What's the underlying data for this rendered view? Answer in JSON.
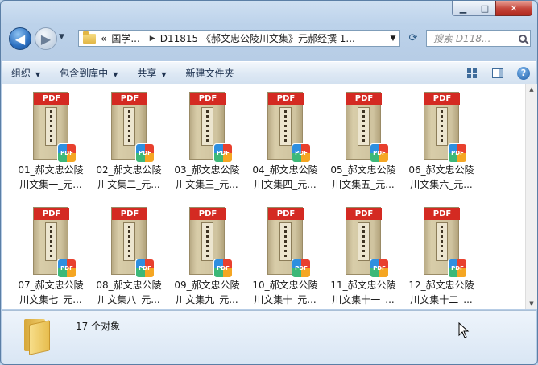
{
  "window": {
    "caption_buttons": {
      "minimize": "▁",
      "maximize": "□",
      "close": "✕"
    }
  },
  "nav": {
    "back_glyph": "◀",
    "forward_glyph": "▶",
    "dropdown_glyph": "▼",
    "breadcrumb": {
      "overflow": "«",
      "items": [
        "国学...",
        "D11815 《郝文忠公陵川文集》元郝经撰 1..."
      ],
      "separator": "▶"
    },
    "refresh_glyph": "⟳",
    "search_placeholder": "搜索 D118..."
  },
  "toolbar": {
    "items": [
      {
        "label": "组织",
        "has_menu": true
      },
      {
        "label": "包含到库中",
        "has_menu": true
      },
      {
        "label": "共享",
        "has_menu": true
      },
      {
        "label": "新建文件夹",
        "has_menu": false
      }
    ],
    "menu_arrow": "▼",
    "help_glyph": "?"
  },
  "files": [
    {
      "line1": "01_郝文忠公陵",
      "line2": "川文集一_元..."
    },
    {
      "line1": "02_郝文忠公陵",
      "line2": "川文集二_元..."
    },
    {
      "line1": "03_郝文忠公陵",
      "line2": "川文集三_元..."
    },
    {
      "line1": "04_郝文忠公陵",
      "line2": "川文集四_元..."
    },
    {
      "line1": "05_郝文忠公陵",
      "line2": "川文集五_元..."
    },
    {
      "line1": "06_郝文忠公陵",
      "line2": "川文集六_元..."
    },
    {
      "line1": "07_郝文忠公陵",
      "line2": "川文集七_元..."
    },
    {
      "line1": "08_郝文忠公陵",
      "line2": "川文集八_元..."
    },
    {
      "line1": "09_郝文忠公陵",
      "line2": "川文集九_元..."
    },
    {
      "line1": "10_郝文忠公陵",
      "line2": "川文集十_元..."
    },
    {
      "line1": "11_郝文忠公陵",
      "line2": "川文集十一_..."
    },
    {
      "line1": "12_郝文忠公陵",
      "line2": "川文集十二_..."
    }
  ],
  "thumbnail": {
    "band_text": "PDF",
    "badge_text": "PDF"
  },
  "scrollbar": {
    "up_glyph": "▲",
    "down_glyph": "▼"
  },
  "status": {
    "count_text": "17 个对象"
  },
  "colors": {
    "pdf_red": "#d42a22",
    "window_frame": "#bcd2ea",
    "toolbar": "#dde8f4"
  }
}
